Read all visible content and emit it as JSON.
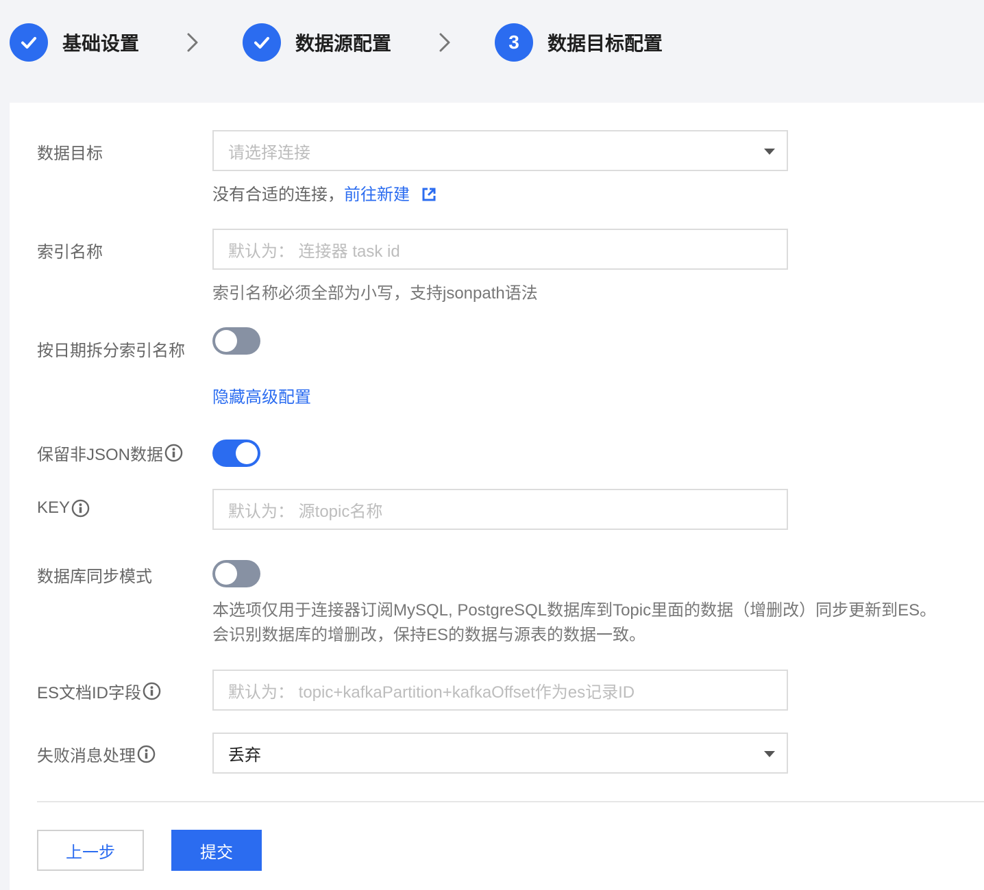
{
  "steps": [
    {
      "label": "基础设置",
      "state": "done"
    },
    {
      "label": "数据源配置",
      "state": "done"
    },
    {
      "label": "数据目标配置",
      "state": "active",
      "number": "3"
    }
  ],
  "form": {
    "target": {
      "label": "数据目标",
      "placeholder": "请选择连接",
      "help_text": "没有合适的连接，",
      "help_link": "前往新建"
    },
    "index_name": {
      "label": "索引名称",
      "placeholder": "默认为：  连接器 task id",
      "help": "索引名称必须全部为小写，支持jsonpath语法"
    },
    "split_by_date": {
      "label": "按日期拆分索引名称",
      "value": false
    },
    "advanced_toggle": "隐藏高级配置",
    "keep_non_json": {
      "label": "保留非JSON数据",
      "value": true
    },
    "key": {
      "label": "KEY",
      "placeholder": "默认为：  源topic名称"
    },
    "db_sync": {
      "label": "数据库同步模式",
      "value": false,
      "help_line1": "本选项仅用于连接器订阅MySQL, PostgreSQL数据库到Topic里面的数据（增删改）同步更新到ES。",
      "help_line2": "会识别数据库的增删改，保持ES的数据与源表的数据一致。"
    },
    "es_doc_id": {
      "label": "ES文档ID字段",
      "placeholder": "默认为：  topic+kafkaPartition+kafkaOffset作为es记录ID"
    },
    "fail_handling": {
      "label": "失败消息处理",
      "value": "丢弃"
    }
  },
  "buttons": {
    "prev": "上一步",
    "submit": "提交"
  },
  "colors": {
    "primary": "#2b6cf0",
    "toggle_off": "#8791a3",
    "background": "#f3f4f7"
  }
}
